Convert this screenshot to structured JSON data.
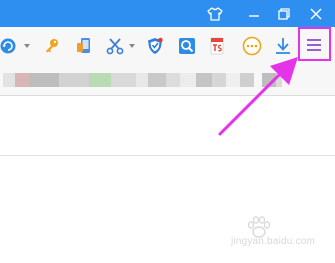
{
  "window": {
    "titlebar_color": "#2f8ff1",
    "buttons": [
      "skin-shirt-icon",
      "minimize-icon",
      "restore-icon",
      "close-icon"
    ]
  },
  "toolbar": {
    "icons": [
      "refresh-icon",
      "key-icon",
      "phone-icon",
      "scissors-icon",
      "shield-icon",
      "search-icon",
      "ts-icon",
      "more-icon",
      "download-icon",
      "menu-icon"
    ],
    "highlight_color": "#e533ea"
  },
  "bookmarks_bar": {
    "state": "blurred"
  },
  "annotation": {
    "arrow_color": "#e533ea",
    "points_to": "menu-icon"
  },
  "watermark": {
    "text": "jingyan.baidu.com"
  }
}
